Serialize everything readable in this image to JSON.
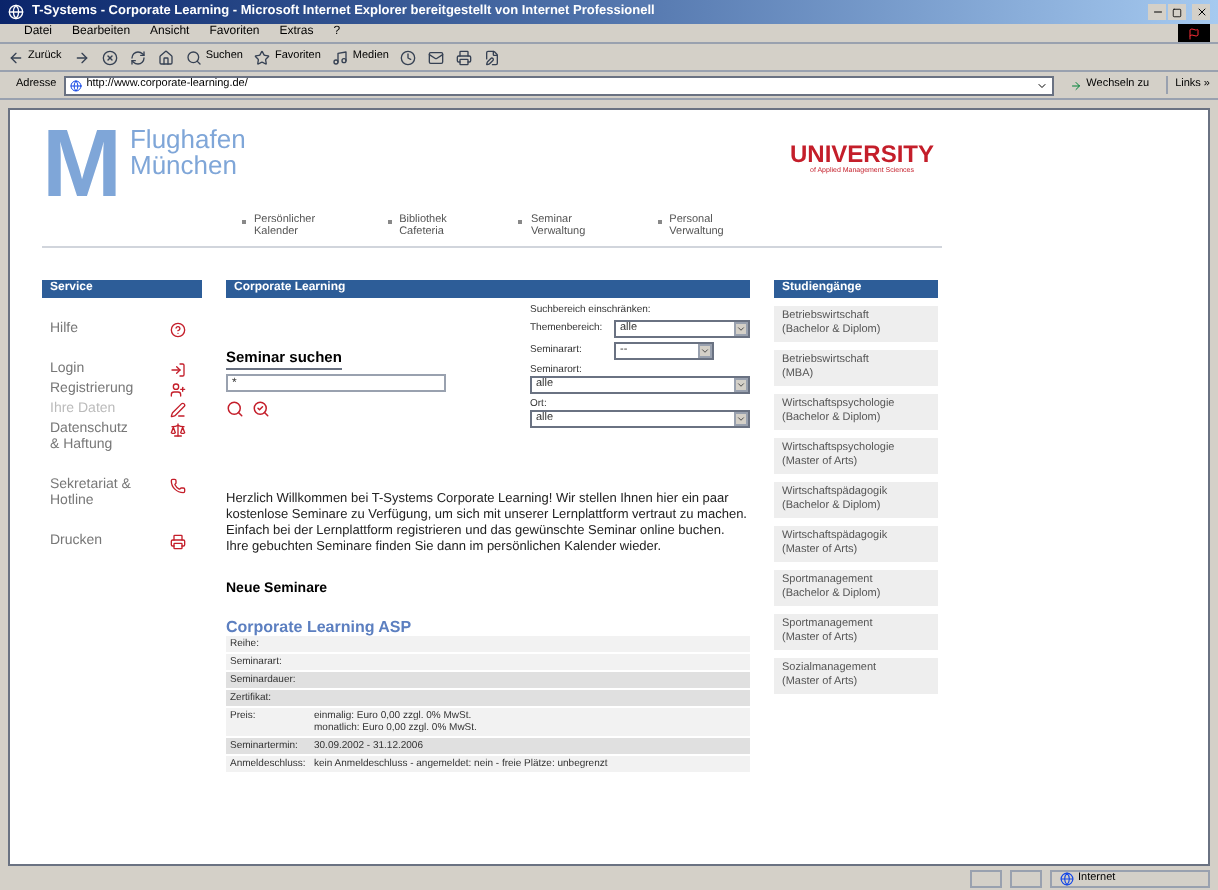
{
  "window": {
    "title": "T-Systems - Corporate Learning - Microsoft Internet Explorer bereitgestellt von Internet Professionell"
  },
  "menu": [
    "Datei",
    "Bearbeiten",
    "Ansicht",
    "Favoriten",
    "Extras",
    "?"
  ],
  "toolbar": [
    {
      "kind": "back",
      "label": "Zurück"
    },
    {
      "kind": "forward"
    },
    {
      "kind": "stop"
    },
    {
      "kind": "refresh"
    },
    {
      "kind": "home"
    },
    {
      "kind": "search",
      "label": "Suchen"
    },
    {
      "kind": "favorites",
      "label": "Favoriten"
    },
    {
      "kind": "media",
      "label": "Medien"
    },
    {
      "kind": "history"
    },
    {
      "kind": "mail"
    },
    {
      "kind": "print"
    },
    {
      "kind": "edit"
    }
  ],
  "address": {
    "label": "Adresse",
    "url": "http://www.corporate-learning.de/",
    "go": "Wechseln zu",
    "links": "Links »"
  },
  "logo": {
    "letter": "M",
    "line1": "Flughafen",
    "line2": "München"
  },
  "university": {
    "name": "UNIVERSITY",
    "tagline": "of Applied Management Sciences"
  },
  "nav": [
    {
      "line1": "Persönlicher",
      "line2": "Kalender"
    },
    {
      "line1": "Bibliothek",
      "line2": "Cafeteria"
    },
    {
      "line1": "Seminar",
      "line2": "Verwaltung"
    },
    {
      "line1": "Personal",
      "line2": "Verwaltung"
    }
  ],
  "service": {
    "title": "Service",
    "groups": [
      [
        {
          "label": "Hilfe",
          "kind": "help",
          "disabled": false
        }
      ],
      [
        {
          "label": "Login",
          "kind": "login",
          "disabled": false
        },
        {
          "label": "Registrierung",
          "kind": "register",
          "disabled": false
        },
        {
          "label": "Ihre Daten",
          "kind": "edit",
          "disabled": true
        },
        {
          "label": "Datenschutz & Haftung",
          "kind": "law",
          "disabled": false
        }
      ],
      [
        {
          "label": "Sekretariat & Hotline",
          "kind": "phone",
          "disabled": false
        }
      ],
      [
        {
          "label": "Drucken",
          "kind": "print",
          "disabled": false
        }
      ]
    ]
  },
  "main": {
    "title": "Corporate Learning",
    "search_title": "Seminar suchen",
    "search_value": "*",
    "filter_title": "Suchbereich einschränken:",
    "filters": [
      {
        "kind": "inline",
        "label": "Themenbereich:",
        "value": "alle",
        "wide": true
      },
      {
        "kind": "inline",
        "label": "Seminarart:",
        "value": "--",
        "wide": false
      },
      {
        "kind": "stacked",
        "label": "Seminarort:",
        "value": "alle"
      },
      {
        "kind": "stacked",
        "label": "Ort:",
        "value": "alle"
      }
    ],
    "welcome": "Herzlich Willkommen bei T-Systems Corporate Learning! Wir stellen Ihnen hier ein paar kostenlose Seminare zu Verfügung, um sich mit unserer Lernplattform vertraut zu machen. Einfach bei der Lernplattform registrieren und das gewünschte Seminar online buchen. Ihre gebuchten Seminare finden Sie dann im persönlichen Kalender wieder.",
    "new_title": "Neue Seminare",
    "seminar_link": "Corporate Learning ASP",
    "details": [
      {
        "label": "Reihe:",
        "shaded": false
      },
      {
        "label": "Seminarart:",
        "shaded": false
      },
      {
        "label": "Seminardauer:",
        "shaded": true
      },
      {
        "label": "Zertifikat:",
        "shaded": true
      },
      {
        "label": "Preis:",
        "values": [
          "einmalig: Euro 0,00 zzgl. 0% MwSt.",
          "monatlich: Euro 0,00 zzgl. 0% MwSt."
        ],
        "shaded": false
      },
      {
        "label": "Seminartermin:",
        "values": [
          "30.09.2002 - 31.12.2006"
        ],
        "shaded": true
      },
      {
        "label": "Anmeldeschluss:",
        "values": [
          "kein Anmeldeschluss - angemeldet: nein - freie Plätze: unbegrenzt"
        ],
        "shaded": false
      }
    ]
  },
  "studies": {
    "title": "Studiengänge",
    "items": [
      {
        "line1": "Betriebswirtschaft",
        "line2": "(Bachelor & Diplom)"
      },
      {
        "line1": "Betriebswirtschaft",
        "line2": "(MBA)"
      },
      {
        "line1": "Wirtschaftspsychologie",
        "line2": "(Bachelor & Diplom)"
      },
      {
        "line1": "Wirtschaftspsychologie",
        "line2": "(Master of Arts)"
      },
      {
        "line1": "Wirtschaftspädagogik",
        "line2": "(Bachelor & Diplom)"
      },
      {
        "line1": "Wirtschaftspädagogik",
        "line2": "(Master of Arts)"
      },
      {
        "line1": "Sportmanagement",
        "line2": "(Bachelor & Diplom)"
      },
      {
        "line1": "Sportmanagement",
        "line2": "(Master of Arts)"
      },
      {
        "line1": "Sozialmanagement",
        "line2": "(Master of Arts)"
      }
    ]
  },
  "status_bar": {
    "zone": "Internet"
  }
}
